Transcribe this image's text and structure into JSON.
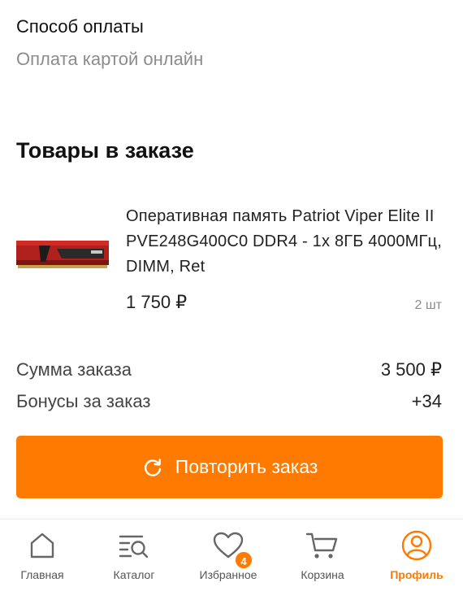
{
  "payment": {
    "title": "Способ оплаты",
    "value": "Оплата картой онлайн"
  },
  "order_items": {
    "title": "Товары в заказе",
    "items": [
      {
        "name": "Оперативная память Patriot Viper Elite II PVE248G400C0 DDR4 -  1x 8ГБ 4000МГц, DIMM,  Ret",
        "price": "1 750 ₽",
        "quantity": "2 шт"
      }
    ]
  },
  "summary": {
    "total_label": "Сумма заказа",
    "total_value": "3 500 ₽",
    "bonus_label": "Бонусы за заказ",
    "bonus_value": "+34"
  },
  "actions": {
    "repeat_label": "Повторить заказ",
    "repeat_icon": "refresh-icon"
  },
  "bottom_nav": {
    "items": [
      {
        "label": "Главная",
        "icon": "home-icon"
      },
      {
        "label": "Каталог",
        "icon": "catalog-search-icon"
      },
      {
        "label": "Избранное",
        "icon": "heart-icon",
        "badge": "4"
      },
      {
        "label": "Корзина",
        "icon": "cart-icon"
      },
      {
        "label": "Профиль",
        "icon": "profile-icon",
        "active": true
      }
    ]
  },
  "colors": {
    "accent": "#ff7a00",
    "muted_text": "#8c8c8c",
    "text": "#111111"
  }
}
